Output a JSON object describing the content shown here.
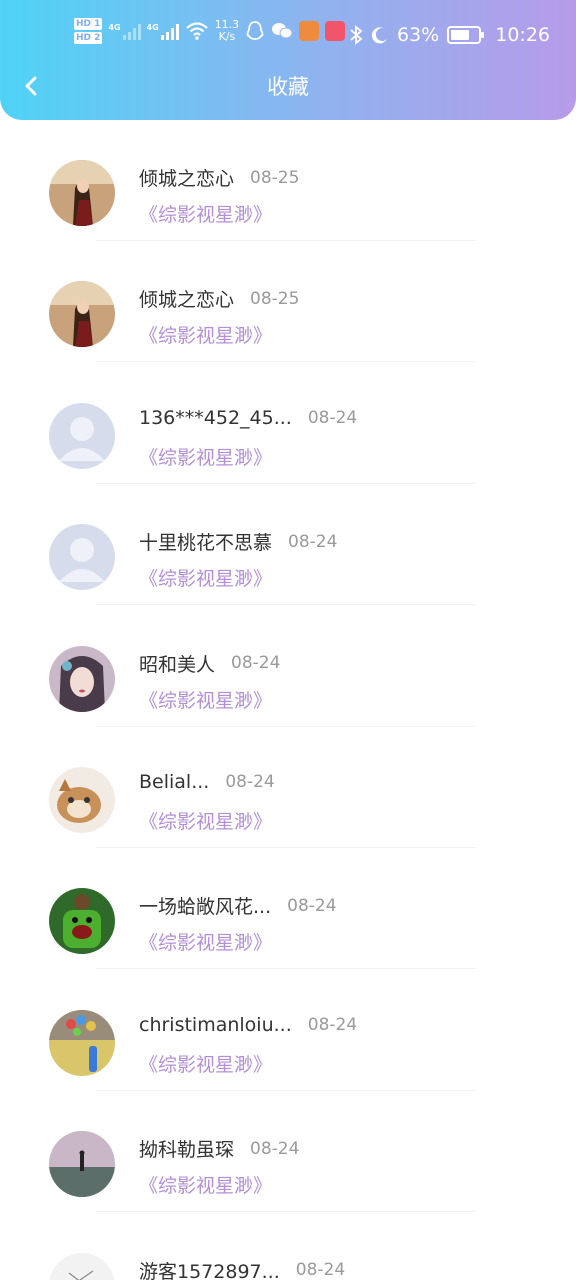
{
  "status_bar": {
    "sim1": "HD 1",
    "sim2": "HD 2",
    "net1": "4G",
    "net2": "4G",
    "speed_value": "11.3",
    "speed_unit": "K/s",
    "battery": "63%",
    "time": "10:26"
  },
  "header": {
    "title": "收藏",
    "back_icon": "chevron-left-icon"
  },
  "favorites": [
    {
      "name": "倾城之恋心",
      "date": "08-25",
      "book": "《综影视星渺》",
      "avatar": "photo-woman"
    },
    {
      "name": "倾城之恋心",
      "date": "08-25",
      "book": "《综影视星渺》",
      "avatar": "photo-woman"
    },
    {
      "name": "136***452_45...",
      "date": "08-24",
      "book": "《综影视星渺》",
      "avatar": "default-user"
    },
    {
      "name": "十里桃花不思慕",
      "date": "08-24",
      "book": "《综影视星渺》",
      "avatar": "default-user"
    },
    {
      "name": "昭和美人",
      "date": "08-24",
      "book": "《综影视星渺》",
      "avatar": "illustrated-girl"
    },
    {
      "name": "Belial...",
      "date": "08-24",
      "book": "《综影视星渺》",
      "avatar": "cat"
    },
    {
      "name": "一场蛤敞风花...",
      "date": "08-24",
      "book": "《综影视星渺》",
      "avatar": "green-monster"
    },
    {
      "name": "christimanloiu...",
      "date": "08-24",
      "book": "《综影视星渺》",
      "avatar": "balloons"
    },
    {
      "name": "拗科勒虽琛",
      "date": "08-24",
      "book": "《综影视星渺》",
      "avatar": "lake-figure"
    },
    {
      "name": "游客1572897...",
      "date": "08-24",
      "book": "",
      "avatar": "sketch"
    }
  ],
  "colors": {
    "header_start": "#4fd3f6",
    "header_end": "#b79be9",
    "book_title": "#b38fd8",
    "date": "#9a9a9a"
  }
}
